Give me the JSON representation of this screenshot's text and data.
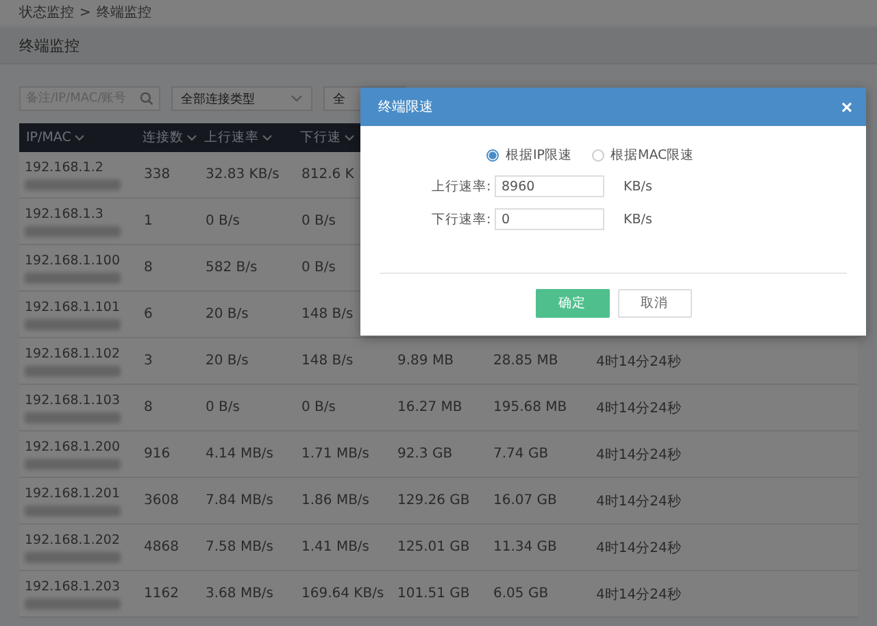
{
  "breadcrumb": {
    "items": [
      "状态监控",
      "终端监控"
    ],
    "separator": ">"
  },
  "page_title": "终端监控",
  "filters": {
    "search": {
      "placeholder": "备注/IP/MAC/账号"
    },
    "selects": [
      "全部连接类型",
      "全"
    ]
  },
  "table": {
    "columns": [
      "IP/MAC",
      "连接数",
      "上行速率",
      "下行速"
    ],
    "rows": [
      {
        "ip": "192.168.1.2",
        "connections": "338",
        "upload": "32.83 KB/s",
        "download": "812.6 K"
      },
      {
        "ip": "192.168.1.3",
        "connections": "1",
        "upload": "0 B/s",
        "download": "0 B/s"
      },
      {
        "ip": "192.168.1.100",
        "connections": "8",
        "upload": "582 B/s",
        "download": "0 B/s"
      },
      {
        "ip": "192.168.1.101",
        "connections": "6",
        "upload": "20 B/s",
        "download": "148 B/s"
      },
      {
        "ip": "192.168.1.102",
        "connections": "3",
        "upload": "20 B/s",
        "download": "148 B/s",
        "column_5": "9.89 MB",
        "column_6": "28.85 MB",
        "column_7": "4时14分24秒"
      },
      {
        "ip": "192.168.1.103",
        "connections": "8",
        "upload": "0 B/s",
        "download": "0 B/s",
        "column_5": "16.27 MB",
        "column_6": "195.68 MB",
        "column_7": "4时14分24秒"
      },
      {
        "ip": "192.168.1.200",
        "connections": "916",
        "upload": "4.14 MB/s",
        "download": "1.71 MB/s",
        "column_5": "92.3 GB",
        "column_6": "7.74 GB",
        "column_7": "4时14分24秒"
      },
      {
        "ip": "192.168.1.201",
        "connections": "3608",
        "upload": "7.84 MB/s",
        "download": "1.86 MB/s",
        "column_5": "129.26 GB",
        "column_6": "16.07 GB",
        "column_7": "4时14分24秒"
      },
      {
        "ip": "192.168.1.202",
        "connections": "4868",
        "upload": "7.58 MB/s",
        "download": "1.41 MB/s",
        "column_5": "125.01 GB",
        "column_6": "11.34 GB",
        "column_7": "4时14分24秒"
      },
      {
        "ip": "192.168.1.203",
        "connections": "1162",
        "upload": "3.68 MB/s",
        "download": "169.64 KB/s",
        "column_5": "101.51 GB",
        "column_6": "6.05 GB",
        "column_7": "4时14分24秒"
      }
    ]
  },
  "dialog": {
    "title": "终端限速",
    "close": "×",
    "modes": [
      {
        "label": "根据IP限速",
        "selected": true
      },
      {
        "label": "根据MAC限速",
        "selected": false
      }
    ],
    "fields": [
      {
        "label": "上行速率:",
        "value": "8960",
        "unit": "KB/s"
      },
      {
        "label": "下行速率:",
        "value": "0",
        "unit": "KB/s"
      }
    ],
    "buttons": [
      {
        "label": "确定",
        "kind": "primary"
      },
      {
        "label": "取消",
        "kind": "secondary"
      }
    ]
  }
}
